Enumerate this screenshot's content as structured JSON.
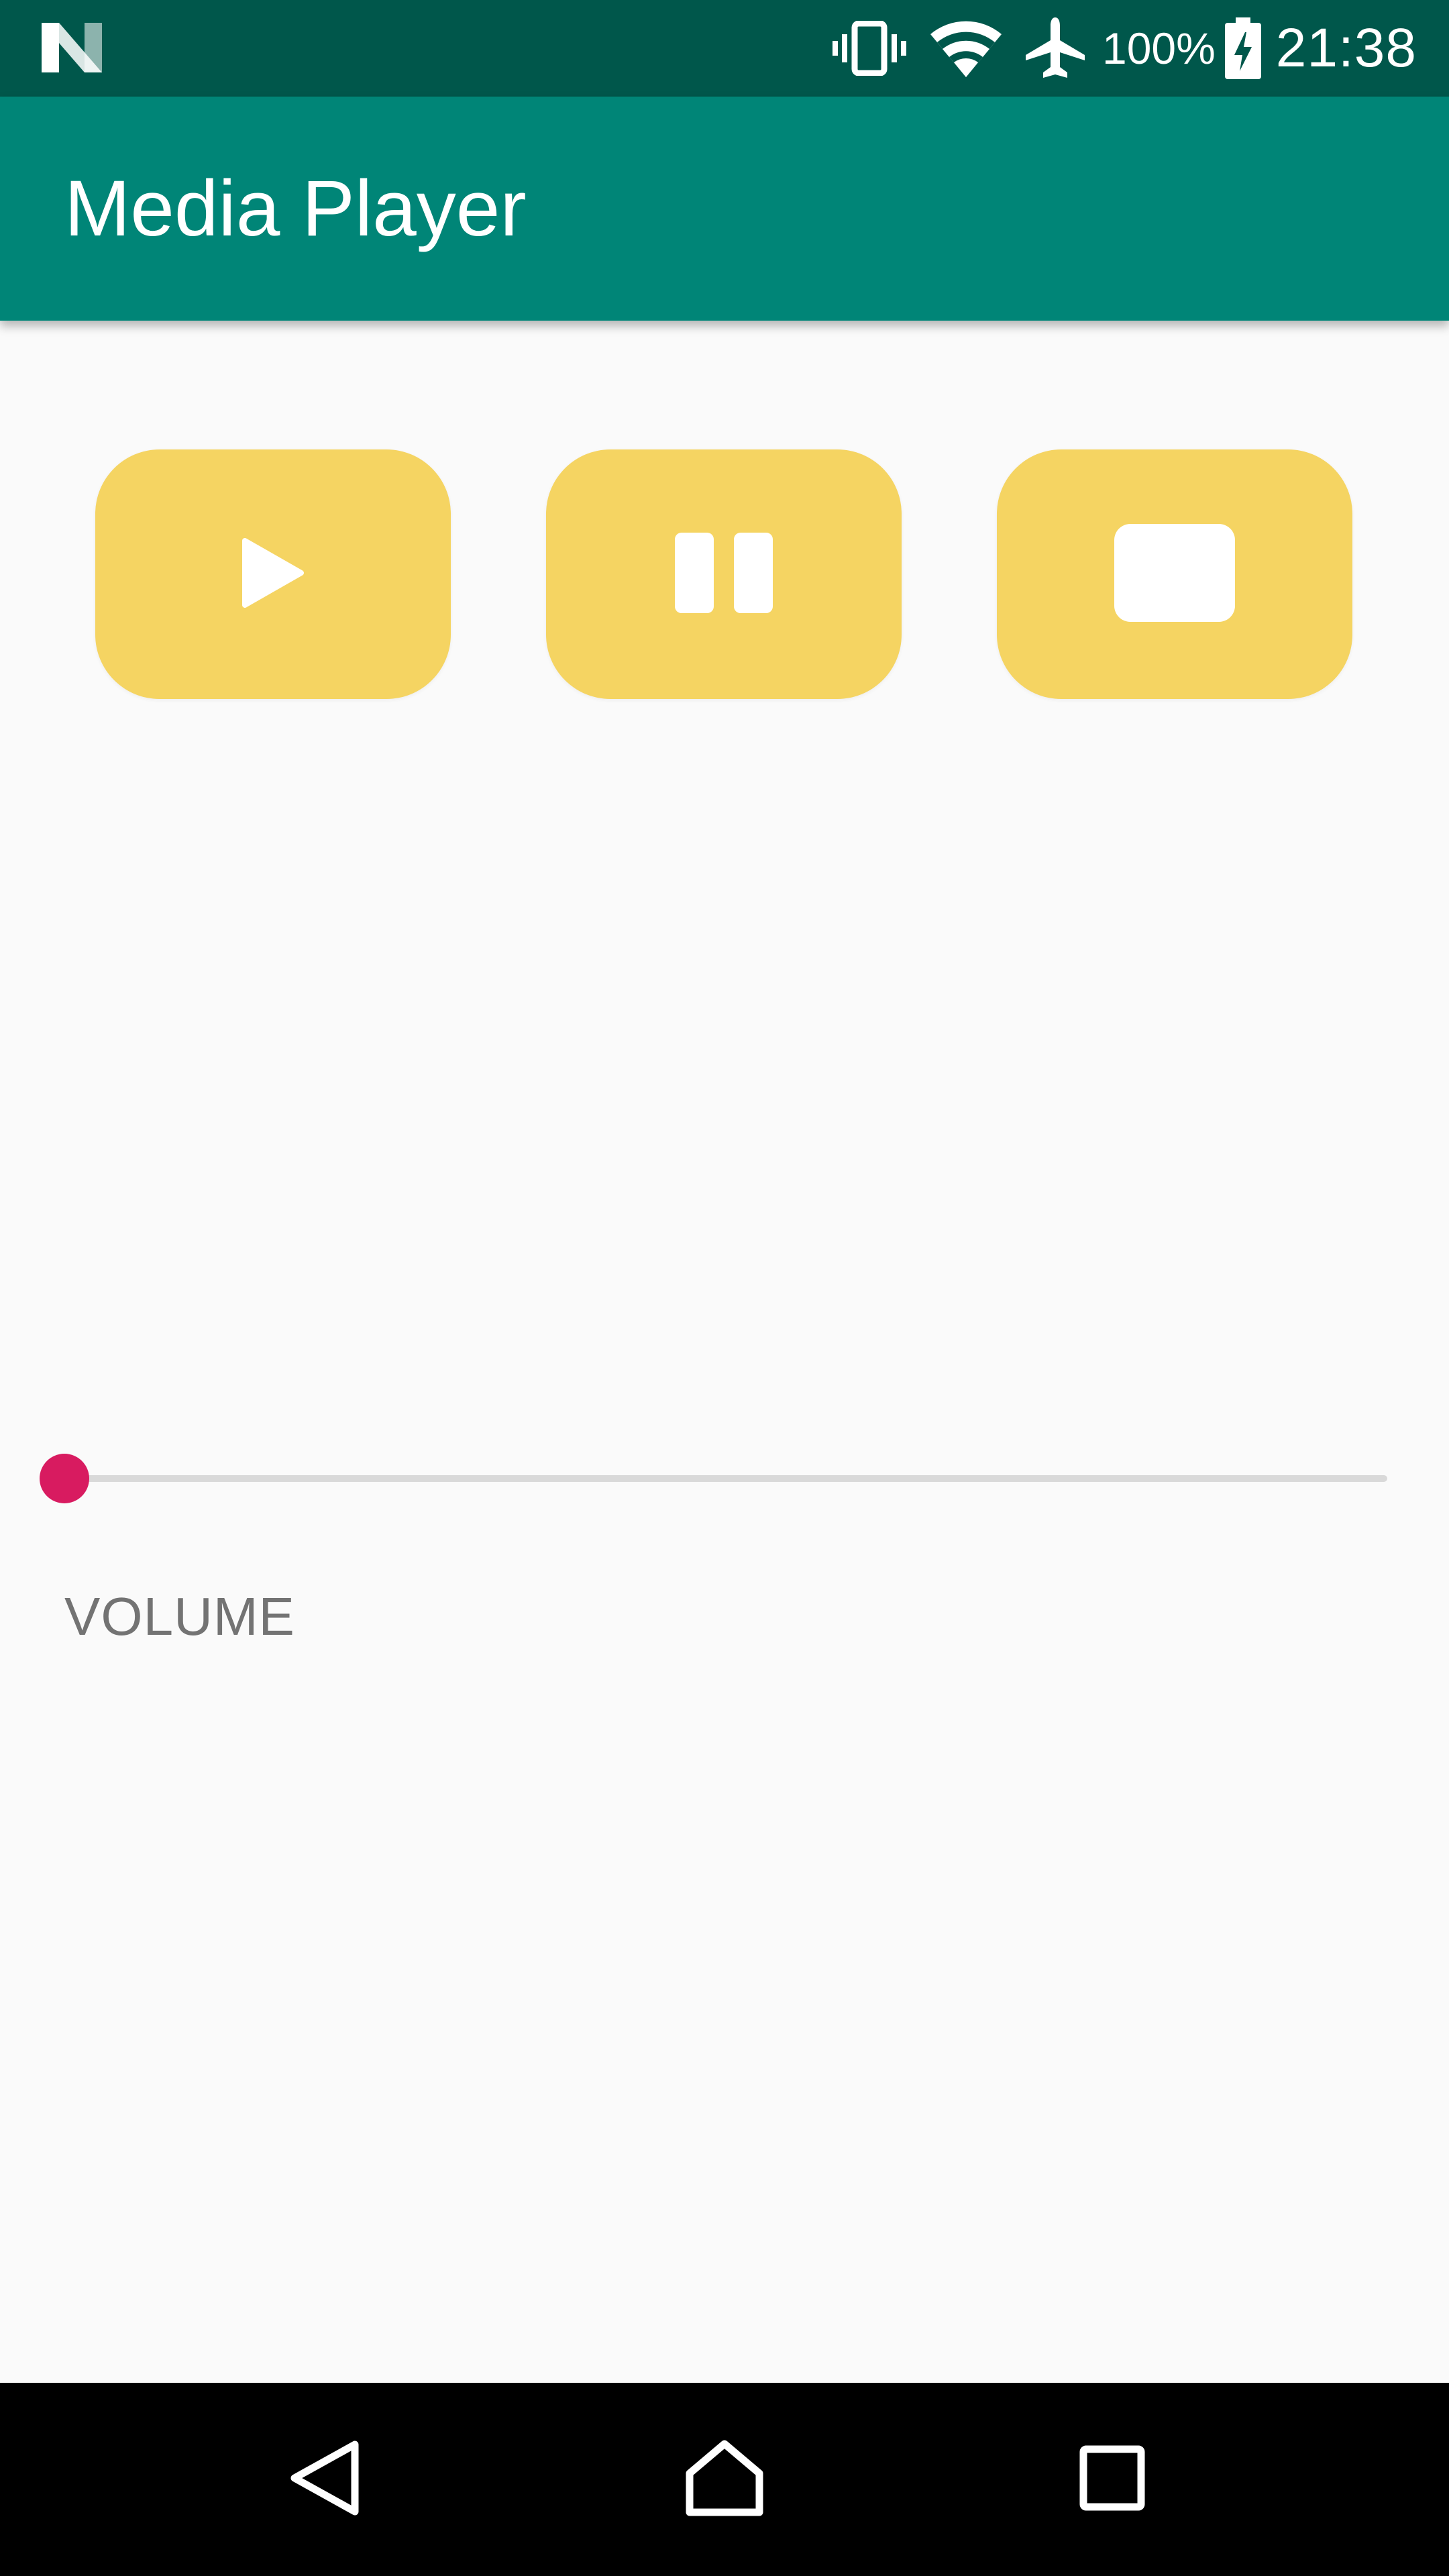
{
  "status_bar": {
    "notification_icon": "n-logo-icon",
    "icons": [
      "vibrate-icon",
      "wifi-icon",
      "airplane-icon",
      "battery-charging-icon"
    ],
    "battery": "100%",
    "time": "21:38"
  },
  "app_bar": {
    "title": "Media Player"
  },
  "controls": [
    {
      "name": "play",
      "icon": "play-icon"
    },
    {
      "name": "pause",
      "icon": "pause-icon"
    },
    {
      "name": "stop",
      "icon": "stop-icon"
    }
  ],
  "volume": {
    "label": "VOLUME",
    "level": 0
  },
  "nav_bar": {
    "icons": [
      "back-icon",
      "home-icon",
      "recents-icon"
    ]
  },
  "colors": {
    "status_bar": "#00574b",
    "app_bar": "#008577",
    "button": "#f5d462",
    "accent": "#d81b60",
    "background": "#fafafa",
    "label": "#737373"
  }
}
